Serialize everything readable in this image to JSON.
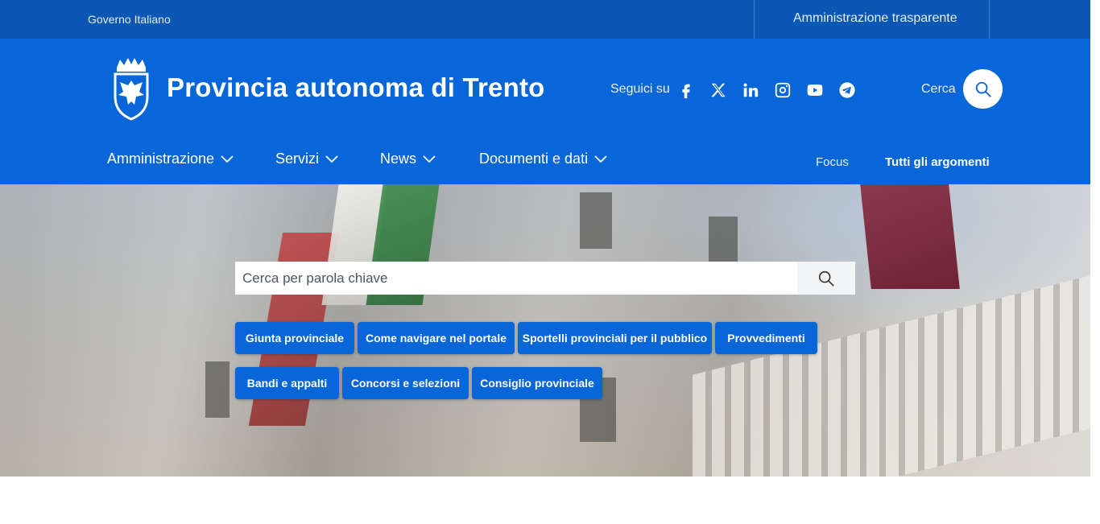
{
  "topbar": {
    "government": "Governo Italiano",
    "transparency": "Amministrazione trasparente"
  },
  "header": {
    "title": "Provincia autonoma di Trento",
    "follow_label": "Seguici su",
    "social": [
      "facebook-icon",
      "x-icon",
      "linkedin-icon",
      "instagram-icon",
      "youtube-icon",
      "telegram-icon"
    ],
    "search_label": "Cerca"
  },
  "nav": {
    "items": [
      {
        "label": "Amministrazione"
      },
      {
        "label": "Servizi"
      },
      {
        "label": "News"
      },
      {
        "label": "Documenti e dati"
      }
    ],
    "focus": "Focus",
    "all_topics": "Tutti gli argomenti"
  },
  "hero": {
    "search_placeholder": "Cerca per parola chiave",
    "quick_links_row1": [
      "Giunta provinciale",
      "Come navigare nel portale",
      "Sportelli provinciali per il pubblico",
      "Provvedimenti"
    ],
    "quick_links_row2": [
      "Bandi e appalti",
      "Concorsi e selezioni",
      "Consiglio provinciale"
    ]
  },
  "colors": {
    "primary": "#0966d9",
    "topbar": "#0a57b4"
  }
}
